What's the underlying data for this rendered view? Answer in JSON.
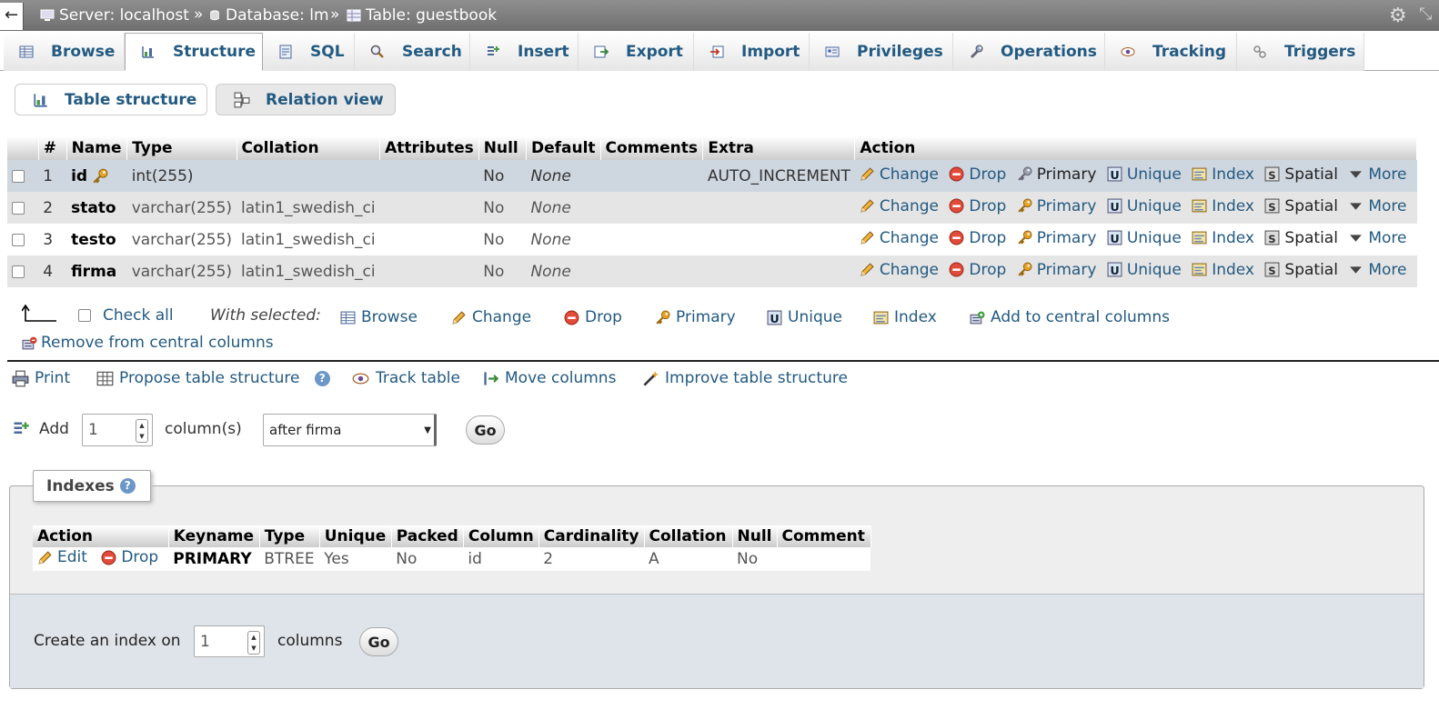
{
  "breadcrumb": {
    "server": "Server: localhost",
    "database": "Database: lm",
    "table": "Table: guestbook",
    "separator": "»"
  },
  "tabs": [
    {
      "label": "Browse"
    },
    {
      "label": "Structure"
    },
    {
      "label": "SQL"
    },
    {
      "label": "Search"
    },
    {
      "label": "Insert"
    },
    {
      "label": "Export"
    },
    {
      "label": "Import"
    },
    {
      "label": "Privileges"
    },
    {
      "label": "Operations"
    },
    {
      "label": "Tracking"
    },
    {
      "label": "Triggers"
    }
  ],
  "subtabs": {
    "structure": "Table structure",
    "relation": "Relation view"
  },
  "structure": {
    "headers": [
      "#",
      "Name",
      "Type",
      "Collation",
      "Attributes",
      "Null",
      "Default",
      "Comments",
      "Extra",
      "Action"
    ],
    "rows": [
      {
        "num": "1",
        "name": "id",
        "type": "int(255)",
        "collation": "",
        "attributes": "",
        "null": "No",
        "default": "None",
        "comments": "",
        "extra": "AUTO_INCREMENT"
      },
      {
        "num": "2",
        "name": "stato",
        "type": "varchar(255)",
        "collation": "latin1_swedish_ci",
        "attributes": "",
        "null": "No",
        "default": "None",
        "comments": "",
        "extra": ""
      },
      {
        "num": "3",
        "name": "testo",
        "type": "varchar(255)",
        "collation": "latin1_swedish_ci",
        "attributes": "",
        "null": "No",
        "default": "None",
        "comments": "",
        "extra": ""
      },
      {
        "num": "4",
        "name": "firma",
        "type": "varchar(255)",
        "collation": "latin1_swedish_ci",
        "attributes": "",
        "null": "No",
        "default": "None",
        "comments": "",
        "extra": ""
      }
    ],
    "actions": {
      "change": "Change",
      "drop": "Drop",
      "primary": "Primary",
      "unique": "Unique",
      "index": "Index",
      "spatial": "Spatial",
      "more": "More"
    }
  },
  "with_selected": {
    "check_all": "Check all",
    "label": "With selected:",
    "browse": "Browse",
    "change": "Change",
    "drop": "Drop",
    "primary": "Primary",
    "unique": "Unique",
    "index": "Index",
    "add_central": "Add to central columns",
    "remove_central": "Remove from central columns"
  },
  "tools": {
    "print": "Print",
    "propose": "Propose table structure",
    "track": "Track table",
    "move": "Move columns",
    "improve": "Improve table structure"
  },
  "add_column": {
    "add_label": "Add",
    "count": "1",
    "columns_label": "column(s)",
    "position": "after firma",
    "go": "Go"
  },
  "indexes": {
    "legend": "Indexes",
    "headers": [
      "Action",
      "Keyname",
      "Type",
      "Unique",
      "Packed",
      "Column",
      "Cardinality",
      "Collation",
      "Null",
      "Comment"
    ],
    "row": {
      "edit": "Edit",
      "drop": "Drop",
      "keyname": "PRIMARY",
      "type": "BTREE",
      "unique": "Yes",
      "packed": "No",
      "column": "id",
      "cardinality": "2",
      "collation": "A",
      "null": "No",
      "comment": ""
    },
    "create_label": "Create an index on",
    "create_count": "1",
    "columns_label": "columns",
    "go": "Go"
  },
  "colors": {
    "link": "#235a81",
    "selected_row": "#ced6df",
    "drop_red": "#e04b3a",
    "primary_gold": "#e8a32a"
  }
}
